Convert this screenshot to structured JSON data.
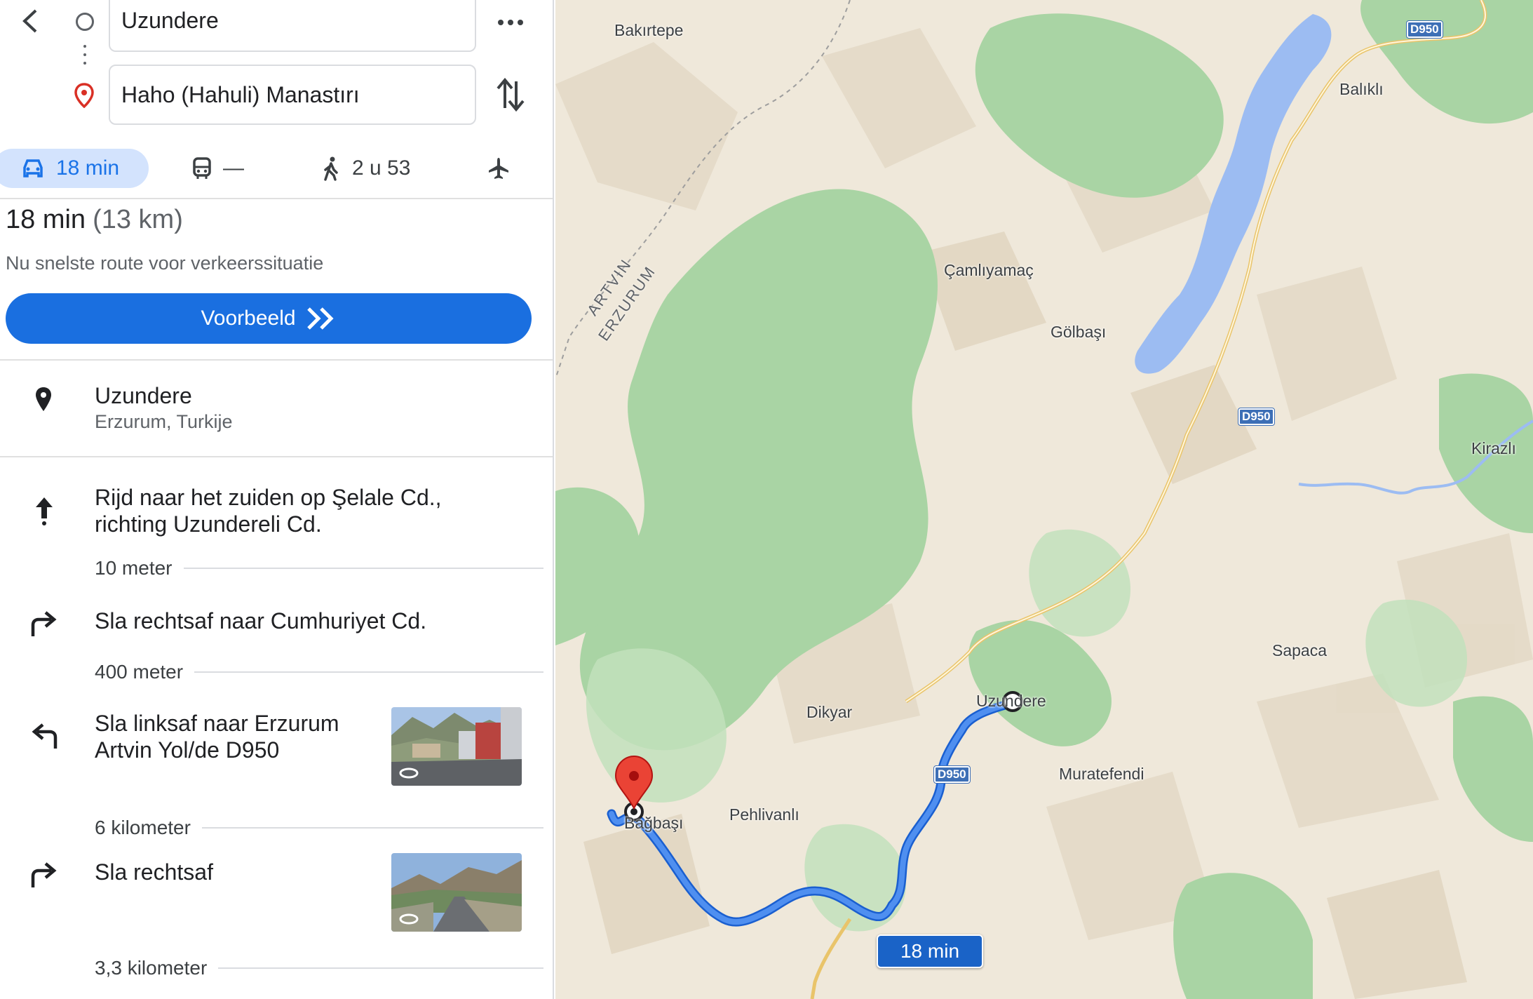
{
  "search": {
    "origin": "Uzundere",
    "destination": "Haho (Hahuli) Manastırı"
  },
  "modes": {
    "car": "18 min",
    "transit": "—",
    "walk": "2 u 53"
  },
  "summary": {
    "time": "18 min",
    "distance": "(13 km)",
    "subtitle": "Nu snelste route voor verkeerssituatie",
    "preview_label": "Voorbeeld"
  },
  "start": {
    "name": "Uzundere",
    "region": "Erzurum, Turkije"
  },
  "steps": [
    {
      "icon": "straight-arrow-icon",
      "line1": "Rijd naar het zuiden op Şelale Cd.,",
      "line2": "richting Uzundereli Cd.",
      "distance": "10 meter"
    },
    {
      "icon": "turn-right-icon",
      "line1": "Sla rechtsaf naar Cumhuriyet Cd.",
      "line2": "",
      "distance": "400 meter"
    },
    {
      "icon": "turn-left-icon",
      "line1": "Sla linksaf naar Erzurum",
      "line2": "Artvin Yol/de D950",
      "distance": "6 kilometer"
    },
    {
      "icon": "turn-right-icon",
      "line1": "Sla rechtsaf",
      "line2": "",
      "distance": "3,3 kilometer"
    }
  ],
  "map": {
    "places": {
      "bakirtepe": "Bakırtepe",
      "balikli": "Balıklı",
      "camliyamac": "Çamlıyamaç",
      "golbasi": "Gölbaşı",
      "kirazli": "Kirazlı",
      "sapaca": "Sapaca",
      "dikyar": "Dikyar",
      "uzundere": "Uzundere",
      "muratefendi": "Muratefendi",
      "pehlivanli": "Pehlivanlı",
      "bagbasi": "Bağbaşı"
    },
    "road": "D950",
    "border_top": "ARTVIN",
    "border_bottom": "ERZURUM",
    "route_label": "18 min"
  },
  "colors": {
    "accent": "#1a73e8",
    "route": "#4285f4",
    "water": "#9cbcf2",
    "forest": "#a8d5a6",
    "terrain": "#efe8da"
  }
}
